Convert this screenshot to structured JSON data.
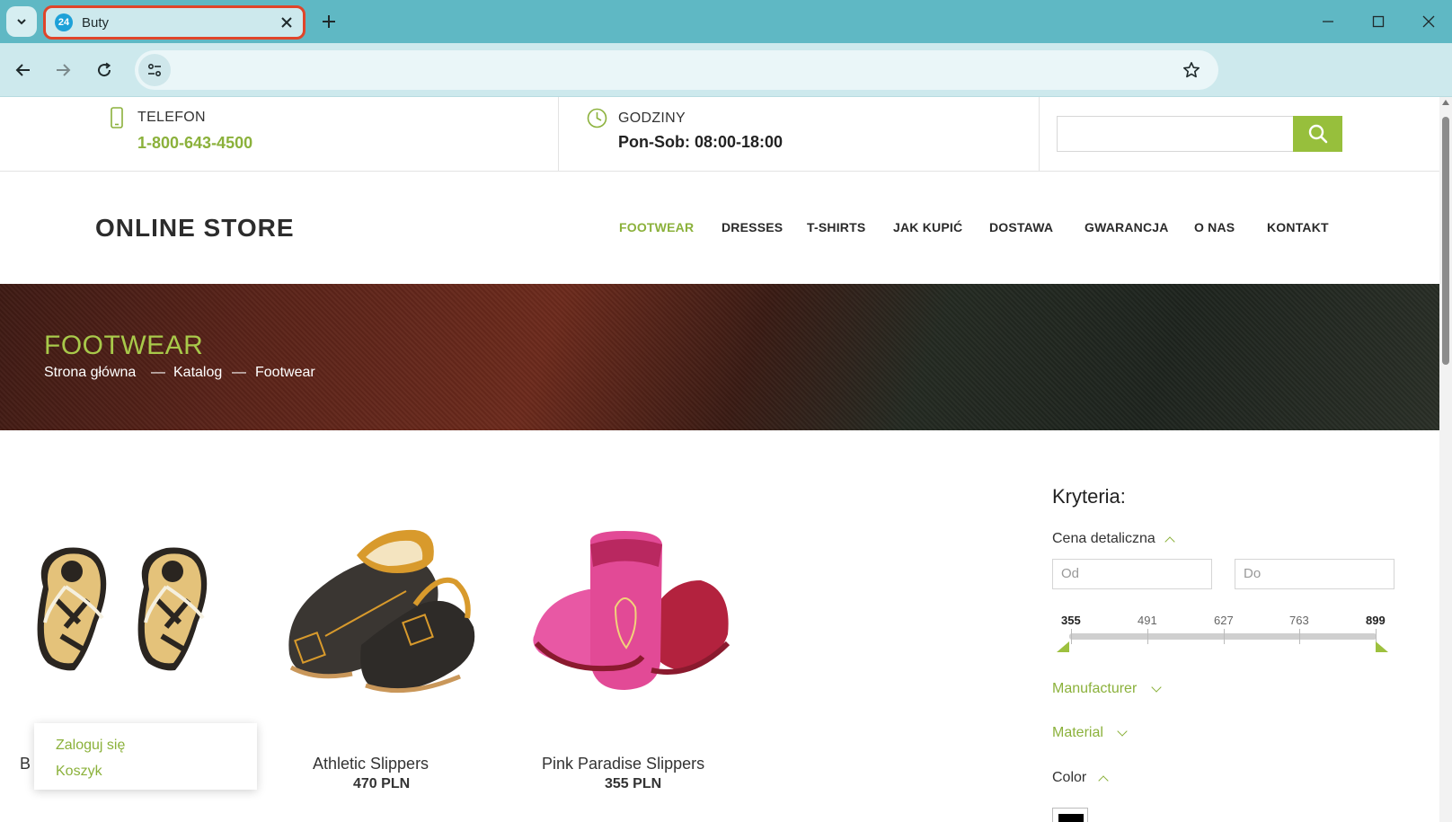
{
  "browser": {
    "tab": {
      "favicon_text": "24",
      "title": "Buty"
    },
    "address": ""
  },
  "infobar": {
    "phone_label": "TELEFON",
    "phone_value": "1-800-643-4500",
    "hours_label": "GODZINY",
    "hours_value": "Pon-Sob: 08:00-18:00"
  },
  "header": {
    "logo": "ONLINE STORE",
    "nav": [
      "FOOTWEAR",
      "DRESSES",
      "T-SHIRTS",
      "JAK KUPIĆ",
      "DOSTAWA",
      "GWARANCJA",
      "O NAS",
      "KONTAKT"
    ]
  },
  "banner": {
    "title": "FOOTWEAR",
    "breadcrumb": [
      "Strona główna",
      "Katalog",
      "Footwear"
    ],
    "separator": "—"
  },
  "products": [
    {
      "name": "B",
      "price": ""
    },
    {
      "name": "Athletic Slippers",
      "price": "470 PLN"
    },
    {
      "name": "Pink Paradise Slippers",
      "price": "355 PLN"
    }
  ],
  "popup": {
    "login": "Zaloguj się",
    "cart": "Koszyk"
  },
  "filters": {
    "title": "Kryteria:",
    "price_label": "Cena detaliczna",
    "from_placeholder": "Od",
    "to_placeholder": "Do",
    "slider_ticks": [
      "355",
      "491",
      "627",
      "763",
      "899"
    ],
    "range_min": 355,
    "range_max": 899,
    "manufacturer": "Manufacturer",
    "material": "Material",
    "color": "Color"
  },
  "colors": {
    "accent": "#8bb13b",
    "tab_strip": "#5fb8c4",
    "tab_outline": "#e0452a"
  }
}
